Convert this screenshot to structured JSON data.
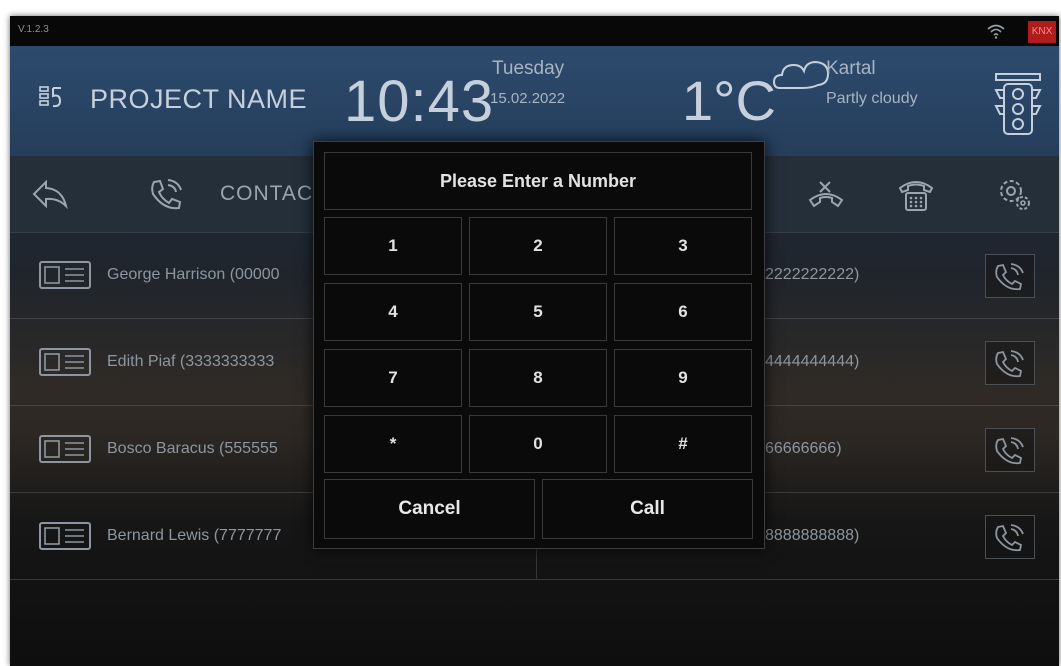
{
  "status_bar": {
    "version": "V.1.2.3",
    "knx_badge": "KNX",
    "icons": [
      "wifi-icon"
    ]
  },
  "header": {
    "project_name": "PROJECT NAME",
    "time": "10:43",
    "day": "Tuesday",
    "date": "15.02.2022",
    "temperature": "1°C",
    "city": "Kartal",
    "weather": "Partly cloudy",
    "icons": [
      "project-icon",
      "cloud-icon",
      "traffic-light-icon"
    ]
  },
  "toolbar": {
    "contacts_label": "CONTAC",
    "icons": [
      "back-icon",
      "phone-icon",
      "hang-up-icon",
      "keypad-phone-icon",
      "settings-icon"
    ]
  },
  "contacts": {
    "left": [
      "George Harrison (00000",
      "Edith Piaf (3333333333",
      "Bosco Baracus (555555",
      "Bernard Lewis (7777777"
    ],
    "right": [
      "2222222222)",
      "4444444444)",
      "66666666)",
      "8888888888)"
    ]
  },
  "dialog": {
    "title": "Please Enter a Number",
    "keys": [
      "1",
      "2",
      "3",
      "4",
      "5",
      "6",
      "7",
      "8",
      "9",
      "*",
      "0",
      "#"
    ],
    "cancel_label": "Cancel",
    "call_label": "Call"
  },
  "colors": {
    "accent": "#2d4a6d",
    "knx": "#b01b1b",
    "dialog_bg": "#0a0a0a"
  }
}
